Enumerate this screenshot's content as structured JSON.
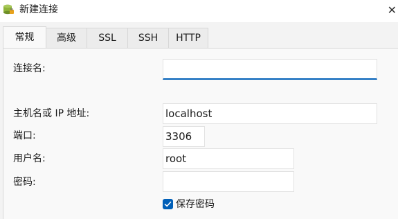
{
  "window": {
    "title": "新建连接",
    "close_glyph": "✕"
  },
  "tabs": [
    {
      "label": "常规",
      "active": true
    },
    {
      "label": "高级",
      "active": false
    },
    {
      "label": "SSL",
      "active": false
    },
    {
      "label": "SSH",
      "active": false
    },
    {
      "label": "HTTP",
      "active": false
    }
  ],
  "form": {
    "connection_name": {
      "label": "连接名:",
      "value": ""
    },
    "host": {
      "label": "主机名或 IP 地址:",
      "value": "localhost"
    },
    "port": {
      "label": "端口:",
      "value": "3306"
    },
    "username": {
      "label": "用户名:",
      "value": "root"
    },
    "password": {
      "label": "密码:",
      "value": ""
    },
    "save_password": {
      "label": "保存密码",
      "checked": true
    }
  },
  "colors": {
    "accent": "#005fb8",
    "window_bg": "#f3f3f3",
    "panel_bg": "#f9f9f9"
  },
  "icons": {
    "app": "database-plug-icon",
    "checkbox": "checkmark-icon",
    "close": "close-icon"
  }
}
